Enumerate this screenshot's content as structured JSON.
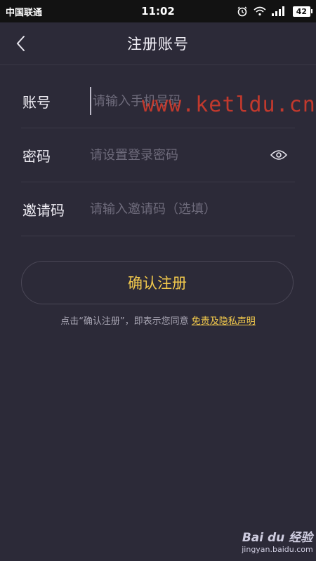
{
  "status_bar": {
    "carrier": "中国联通",
    "time": "11:02",
    "battery": "42",
    "icons": [
      "alarm-icon",
      "wifi-icon",
      "signal-icon",
      "battery-icon"
    ]
  },
  "nav": {
    "title": "注册账号",
    "back_icon": "chevron-left-icon"
  },
  "form": {
    "account": {
      "label": "账号",
      "placeholder": "请输入手机号码"
    },
    "password": {
      "label": "密码",
      "placeholder": "请设置登录密码"
    },
    "invite": {
      "label": "邀请码",
      "placeholder": "请输入邀请码（选填）"
    }
  },
  "submit_label": "确认注册",
  "agreement": {
    "prefix": "点击“确认注册”，即表示您同意 ",
    "link": "免责及隐私声明"
  },
  "watermark": "www.ketldu.cn",
  "badge": {
    "brand": "Bai du 经验",
    "url": "jingyan.baidu.com"
  },
  "colors": {
    "background": "#2c2a38",
    "accent": "#f2c94c",
    "status_bar": "#121212",
    "watermark": "#d23b2c"
  }
}
